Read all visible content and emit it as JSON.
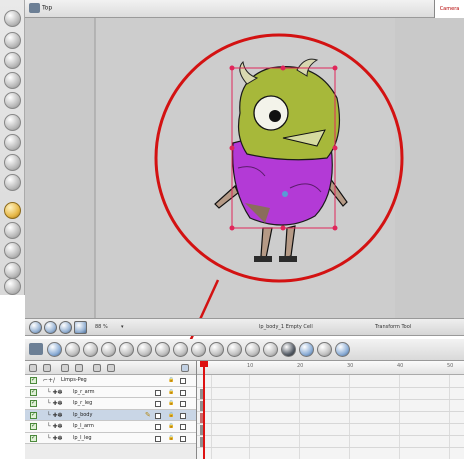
{
  "camera": {
    "nav_label": "Top",
    "tab_label": "Camera"
  },
  "status_bar": {
    "zoom": "88 %",
    "zoom_arrow": "▾",
    "cell_info": "lp_body_1 Empty Cell",
    "current_tool": "Transform Tool"
  },
  "timeline": {
    "ruler_ticks": [
      "10",
      "20",
      "30",
      "40",
      "50"
    ],
    "layers": [
      {
        "name": "Limps-Peg",
        "selected": false
      },
      {
        "name": "lp_r_arm",
        "selected": false
      },
      {
        "name": "lp_r_leg",
        "selected": false
      },
      {
        "name": "lp_body",
        "selected": true
      },
      {
        "name": "lp_l_arm",
        "selected": false
      },
      {
        "name": "lp_l_leg",
        "selected": false
      }
    ]
  },
  "colors": {
    "highlight_circle": "#d31212",
    "bounding_box": "#e0265a",
    "character_green": "#a7b83a",
    "character_purple": "#b33ad6",
    "character_brown": "#8a6d5c"
  }
}
